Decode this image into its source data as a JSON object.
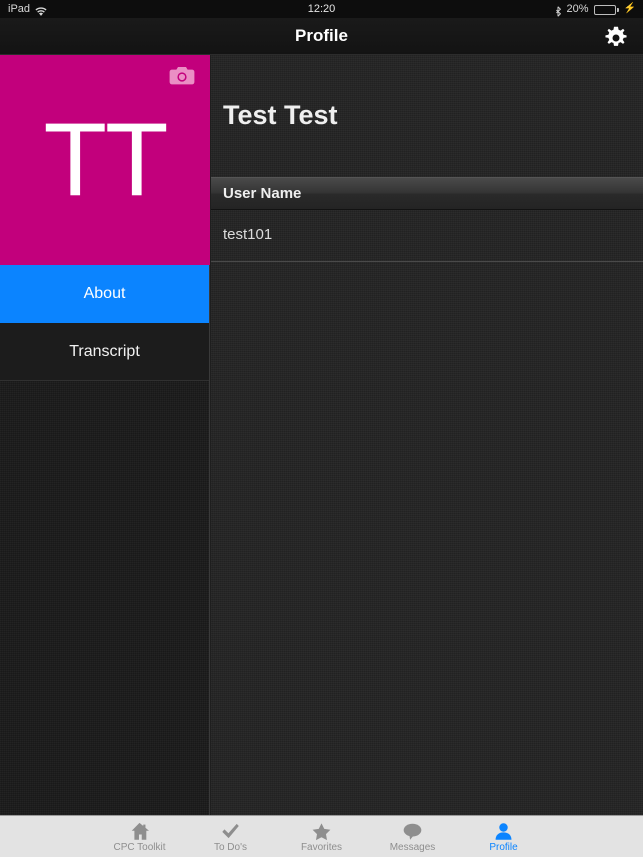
{
  "status_bar": {
    "device_label": "iPad",
    "wifi_icon": "wifi-icon",
    "time": "12:20",
    "bluetooth_icon": "bluetooth-icon",
    "battery_percent": "20%",
    "battery_level": 20,
    "battery_color": "#4cd561",
    "charging_icon": "lightning-bolt-icon"
  },
  "nav_bar": {
    "title": "Profile",
    "settings_icon": "gear-icon"
  },
  "sidebar": {
    "avatar": {
      "initials": "TT",
      "background_color": "#c2007c",
      "camera_icon": "camera-icon"
    },
    "tabs": [
      {
        "label": "About",
        "selected": true
      },
      {
        "label": "Transcript",
        "selected": false
      }
    ],
    "selected_color": "#0b84ff"
  },
  "content": {
    "profile_name": "Test Test",
    "sections": [
      {
        "header": "User Name",
        "value": "test101"
      }
    ]
  },
  "tab_bar": {
    "items": [
      {
        "label": "CPC Toolkit",
        "icon": "home-icon",
        "active": false
      },
      {
        "label": "To Do's",
        "icon": "checkmark-icon",
        "active": false
      },
      {
        "label": "Favorites",
        "icon": "star-icon",
        "active": false
      },
      {
        "label": "Messages",
        "icon": "speech-bubble-icon",
        "active": false
      },
      {
        "label": "Profile",
        "icon": "person-icon",
        "active": true
      }
    ],
    "active_color": "#0b84ff",
    "inactive_color": "#8e8e8e"
  }
}
